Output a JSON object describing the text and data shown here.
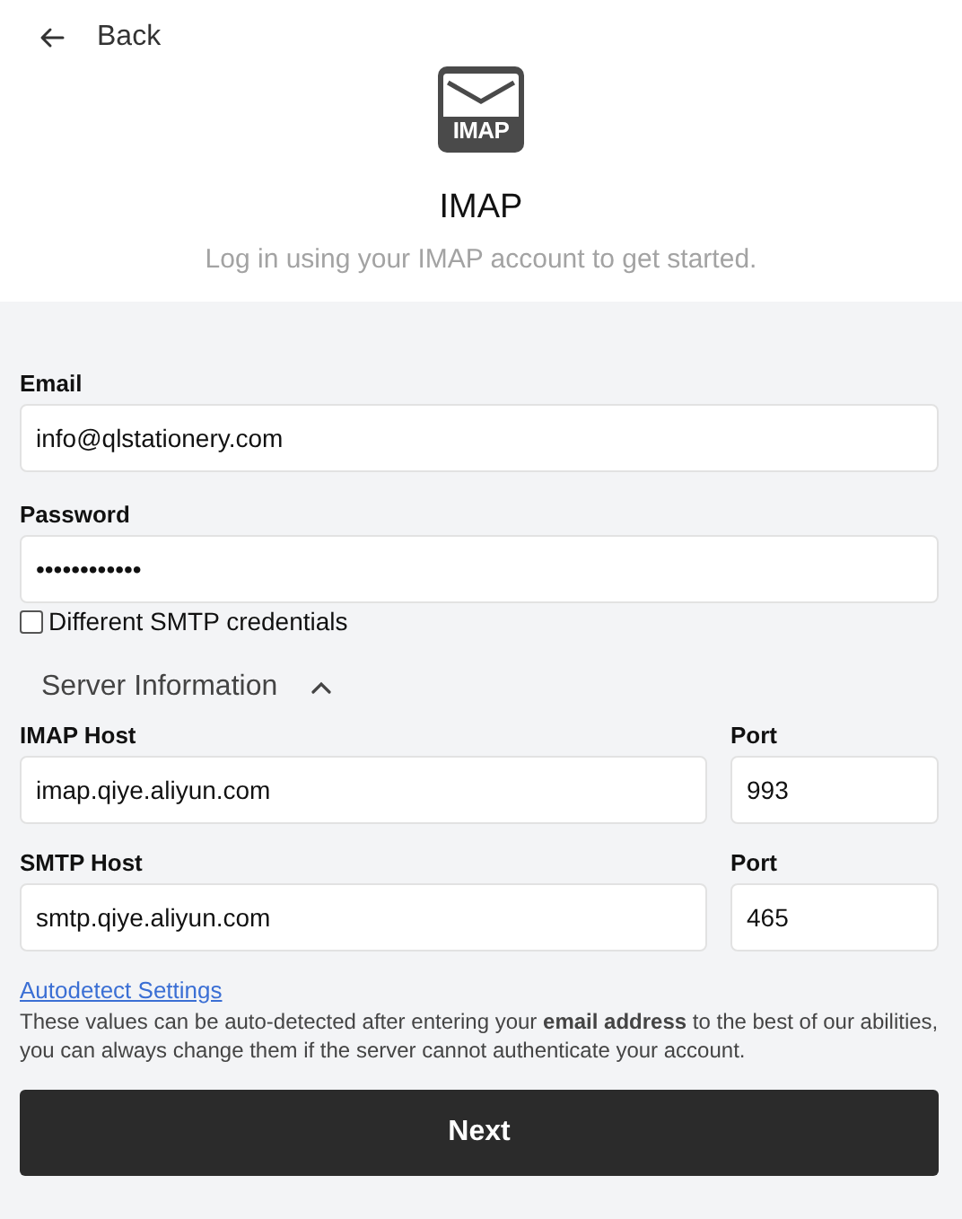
{
  "back": {
    "label": "Back"
  },
  "logo": {
    "badge": "IMAP"
  },
  "title": "IMAP",
  "subtitle": "Log in using your IMAP account to get started.",
  "fields": [
    {
      "label": "Email",
      "value": "info@qlstationery.com"
    },
    {
      "label": "Password",
      "value": "••••••••••••"
    }
  ],
  "smtp_credentials": {
    "label": "Different SMTP credentials",
    "checked": false
  },
  "server_section": {
    "title": "Server Information",
    "expanded": true
  },
  "servers": [
    {
      "host_label": "IMAP Host",
      "host": "imap.qiye.aliyun.com",
      "port_label": "Port",
      "port": "993"
    },
    {
      "host_label": "SMTP Host",
      "host": "smtp.qiye.aliyun.com",
      "port_label": "Port",
      "port": "465"
    }
  ],
  "autodetect": {
    "link": "Autodetect Settings",
    "note": "These values can be auto-detected after entering your **email address** to the best of our abilities, you can always change them if the server cannot authenticate your account."
  },
  "next_button": "Next"
}
